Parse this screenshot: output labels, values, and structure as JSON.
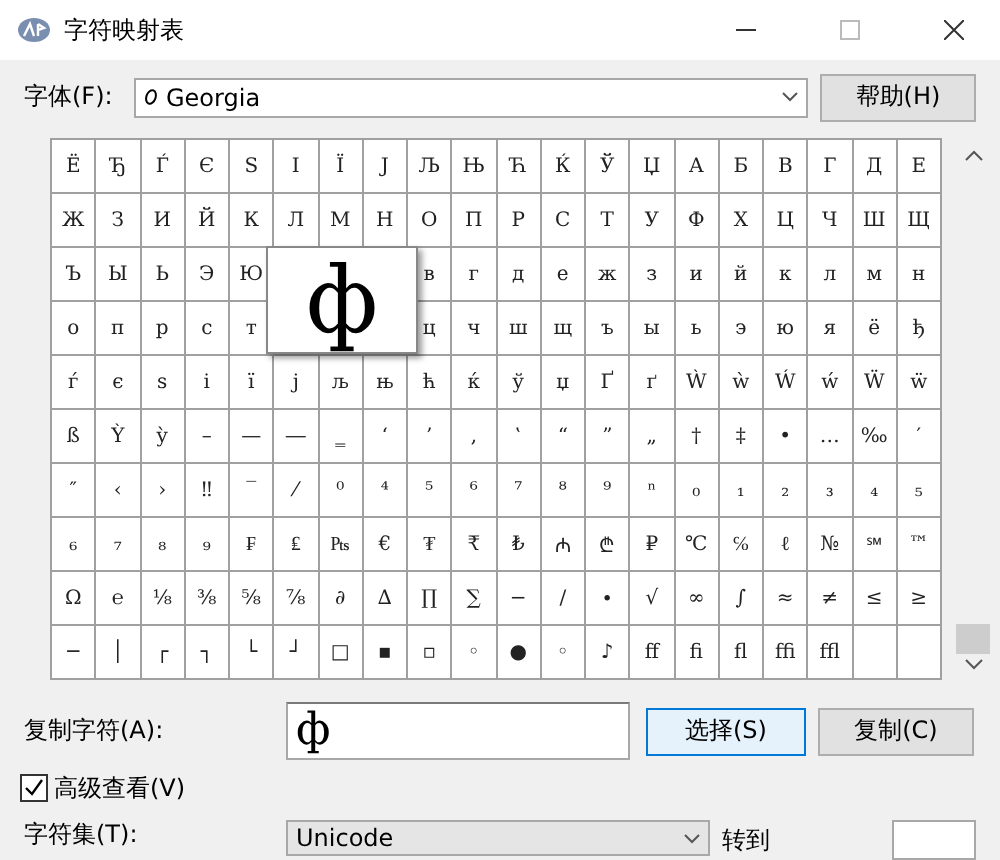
{
  "window": {
    "title": "字符映射表"
  },
  "font": {
    "label": "字体(F):",
    "value": "Georgia"
  },
  "help_button": "帮助(H)",
  "grid": {
    "rows": [
      [
        "Ё",
        "Ђ",
        "Ѓ",
        "Є",
        "Ѕ",
        "І",
        "Ї",
        "Ј",
        "Љ",
        "Њ",
        "Ћ",
        "Ќ",
        "Ў",
        "Џ",
        "А",
        "Б",
        "В",
        "Г",
        "Д",
        "Е"
      ],
      [
        "Ж",
        "З",
        "И",
        "Й",
        "К",
        "Л",
        "М",
        "Н",
        "О",
        "П",
        "Р",
        "С",
        "Т",
        "У",
        "Ф",
        "Х",
        "Ц",
        "Ч",
        "Ш",
        "Щ"
      ],
      [
        "Ъ",
        "Ы",
        "Ь",
        "Э",
        "Ю",
        null,
        null,
        null,
        "в",
        "г",
        "д",
        "е",
        "ж",
        "з",
        "и",
        "й",
        "к",
        "л",
        "м",
        "н"
      ],
      [
        "о",
        "п",
        "р",
        "с",
        "т",
        null,
        null,
        null,
        "ц",
        "ч",
        "ш",
        "щ",
        "ъ",
        "ы",
        "ь",
        "э",
        "ю",
        "я",
        "ё",
        "ђ"
      ],
      [
        "ѓ",
        "є",
        "ѕ",
        "і",
        "ї",
        "ј",
        "љ",
        "њ",
        "ћ",
        "ќ",
        "ў",
        "џ",
        "Ґ",
        "ґ",
        "Ẁ",
        "ẁ",
        "Ẃ",
        "ẃ",
        "Ẅ",
        "ẅ"
      ],
      [
        "ß",
        "Ỳ",
        "ỳ",
        "–",
        "—",
        "―",
        "‗",
        "‘",
        "’",
        "‚",
        "‛",
        "“",
        "”",
        "„",
        "†",
        "‡",
        "•",
        "…",
        "‰",
        "′"
      ],
      [
        "″",
        "‹",
        "›",
        "‼",
        "‾",
        "⁄",
        "⁰",
        "⁴",
        "⁵",
        "⁶",
        "⁷",
        "⁸",
        "⁹",
        "ⁿ",
        "₀",
        "₁",
        "₂",
        "₃",
        "₄",
        "₅"
      ],
      [
        "₆",
        "₇",
        "₈",
        "₉",
        "₣",
        "₤",
        "₧",
        "€",
        "₮",
        "₹",
        "₺",
        "₼",
        "₾",
        "₽",
        "℃",
        "℅",
        "ℓ",
        "№",
        "℠",
        "™"
      ],
      [
        "Ω",
        "℮",
        "⅛",
        "⅜",
        "⅝",
        "⅞",
        "∂",
        "∆",
        "∏",
        "∑",
        "−",
        "∕",
        "∙",
        "√",
        "∞",
        "∫",
        "≈",
        "≠",
        "≤",
        "≥"
      ],
      [
        "─",
        "│",
        "┌",
        "┐",
        "└",
        "┘",
        "□",
        "▪",
        "▫",
        "◦",
        "●",
        "◦",
        "♪",
        "ﬀ",
        "ﬁ",
        "ﬂ",
        "ﬃ",
        "ﬄ"
      ]
    ]
  },
  "magnifier": {
    "char": "ф"
  },
  "copy": {
    "label": "复制字符(A):",
    "value": "ф"
  },
  "buttons": [
    {
      "label": "选择(S)",
      "selected": true
    },
    {
      "label": "复制(C)",
      "selected": false
    }
  ],
  "advanced": {
    "label": "高级查看(V)",
    "checked": true
  },
  "charset": {
    "label": "字符集(T):",
    "value": "Unicode"
  },
  "goto": {
    "label": "转到"
  }
}
